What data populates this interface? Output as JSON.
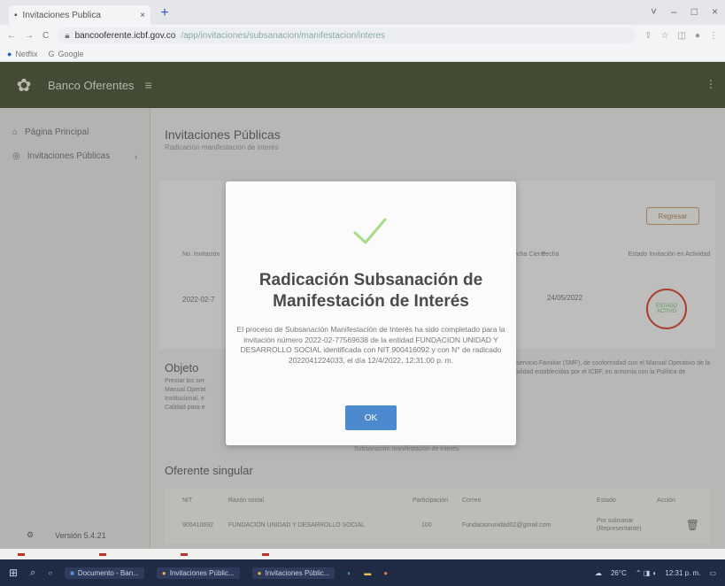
{
  "browser": {
    "tab_title": "Invitaciones Publica",
    "tab_close": "×",
    "new_tab": "+",
    "window_controls": [
      "˅",
      "–",
      "□",
      "×"
    ],
    "nav": {
      "back": "←",
      "forward": "→",
      "reload": "C"
    },
    "url_host": "bancooferente.icbf.gov.co",
    "url_path": "/app/invitaciones/subsanacion/manifestacion/interes",
    "bookmarks": [
      "Netflix",
      "Google"
    ]
  },
  "app": {
    "name": "Banco Oferentes",
    "menu_icon": "≡",
    "user_icon": "⋮"
  },
  "sidebar": {
    "items": [
      {
        "label": "Página Principal"
      },
      {
        "label": "Invitaciones Públicas"
      }
    ],
    "version": "Versión 5.4.21"
  },
  "main": {
    "title": "Invitaciones Públicas",
    "subtitle": "Radicación manifestación de interés",
    "card": {
      "action_button": "Regresar",
      "col_no_invitacion": "No. Invitación",
      "col_fecha_cierre": "Fecha Cierre",
      "col_fecha": "Fecha",
      "col_estado": "Estado Invitación en Actividad",
      "no_invitacion": "2022-02-7",
      "fecha": "24/05/2022",
      "badge_line1": "ESTADO",
      "badge_line2": "ACTIVO"
    },
    "objeto_title": "Objeto",
    "objeto_left": "Prestar los ser Manual Operat Institucional, e Calidad para e",
    "objeto_right": "n el servicio Familiar (SMF), de conformidad con el Manual Operativo de la Modalidad establecidas por el ICBF, en armonía con la Política de",
    "upload_note": "Subsanación manifestación de interés",
    "oferente_title": "Oferente singular",
    "table": {
      "headers": [
        "NIT",
        "Razón social",
        "Participación",
        "Correo",
        "Estado",
        "Acción"
      ],
      "row": [
        "900410692",
        "FUNDACION UNIDAD Y DESARROLLO SOCIAL",
        "100",
        "Fundacionunidad02@gmail.com",
        "Por subsanar (Representante)"
      ]
    }
  },
  "modal": {
    "title": "Radicación Subsanación de Manifestación de Interés",
    "message": "El proceso de Subsanación Manifestación de Interés ha sido completado para la invitación número 2022-02-77569638 de la entidad FUNDACION UNIDAD Y DESARROLLO SOCIAL identificada con NIT 900416092 y con N° de radicado 2022041224033, el día 12/4/2022, 12:31:00 p. m.",
    "ok_label": "OK",
    "accent_color": "#4c89cf",
    "check_color": "#a5dc86"
  },
  "taskbar": {
    "start": "⊞",
    "search": "⌕",
    "apps": [
      "Documento - Ban...",
      "Invitaciones Públic...",
      "Invitaciones Públic..."
    ],
    "weather": "26°C",
    "time": "12:31 p. m."
  }
}
